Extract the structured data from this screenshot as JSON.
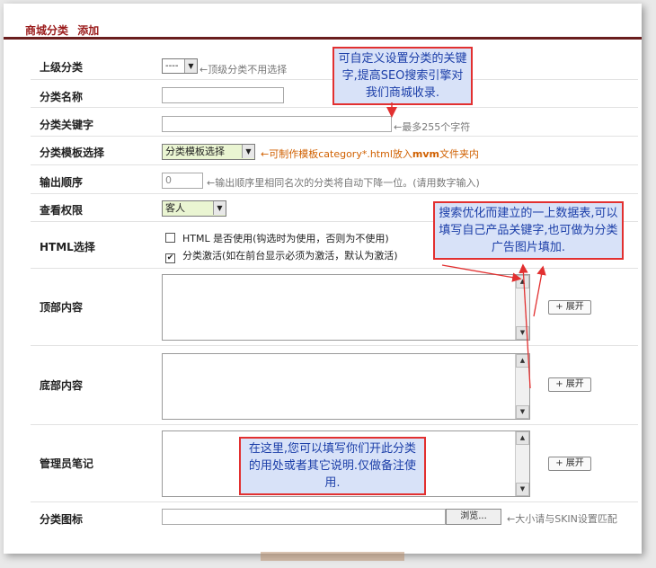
{
  "header": {
    "title": "商城分类",
    "action": "添加"
  },
  "form": {
    "parent": {
      "label": "上级分类",
      "value": "----",
      "hint": "←顶级分类不用选择"
    },
    "name": {
      "label": "分类名称",
      "value": ""
    },
    "keywords": {
      "label": "分类关键字",
      "value": "",
      "hint": "←最多255个字符"
    },
    "template": {
      "label": "分类模板选择",
      "value": "分类模板选择",
      "hint_pre": "←可制作模板category*.html放入",
      "hint_bold": "mvm",
      "hint_post": "文件夹内"
    },
    "order": {
      "label": "输出顺序",
      "value": "0",
      "hint": "←输出顺序里相同名次的分类将自动下降一位。(请用数字输入)"
    },
    "permission": {
      "label": "查看权限",
      "value": "客人"
    },
    "html_opts": {
      "label": "HTML选择",
      "opt1": "HTML 是否使用(钩选时为使用，否则为不使用)",
      "opt2": "分类激活(如在前台显示必须为激活，默认为激活)",
      "opt1_checked": false,
      "opt2_checked": true
    },
    "top_content": {
      "label": "顶部内容",
      "expand": "+ 展开"
    },
    "bottom_content": {
      "label": "底部内容",
      "expand": "+ 展开"
    },
    "admin_note": {
      "label": "管理员笔记",
      "expand": "+ 展开"
    },
    "icon": {
      "label": "分类图标",
      "browse": "浏览...",
      "hint": "←大小请与SKIN设置匹配"
    }
  },
  "callouts": {
    "seo": "可自定义设置分类的关键字,提高SEO搜索引擎对我们商城收录.",
    "content": "搜索优化而建立的一上数据表,可以填写自己产品关键字,也可做为分类广告图片填加.",
    "note": "在这里,您可以填写你们开此分类的用处或者其它说明.仅做备注使用."
  },
  "icons": {
    "dropdown": "chevron-down-icon",
    "scroll_up": "scroll-up-icon",
    "scroll_down": "scroll-down-icon",
    "check": "checkmark-icon"
  },
  "colors": {
    "header_title": "#9b1c1c",
    "header_rule": "#6a1e1e",
    "callout_border": "#e23030",
    "callout_bg": "#d8e2f8",
    "callout_text": "#1b3ea8",
    "hint_orange": "#d06000"
  }
}
